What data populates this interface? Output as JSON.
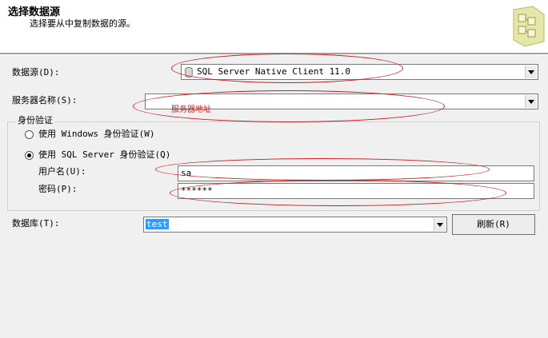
{
  "header": {
    "title": "选择数据源",
    "subtitle": "选择要从中复制数据的源。"
  },
  "form": {
    "datasource_label": "数据源(D):",
    "datasource_value": "SQL Server Native Client 11.0",
    "server_label": "服务器名称(S):",
    "server_value": "",
    "auth_group_label": "身份验证",
    "auth_windows_label": "使用 Windows 身份验证(W)",
    "auth_sql_label": "使用 SQL Server 身份验证(Q)",
    "auth_selected": "sql",
    "username_label": "用户名(U):",
    "username_value": "sa",
    "password_label": "密码(P):",
    "password_value": "******",
    "database_label": "数据库(T):",
    "database_value": "test",
    "refresh_label": "刷新(R)"
  },
  "annotation": {
    "server_hint": "服务器地址",
    "color": "#cc1c1c"
  }
}
